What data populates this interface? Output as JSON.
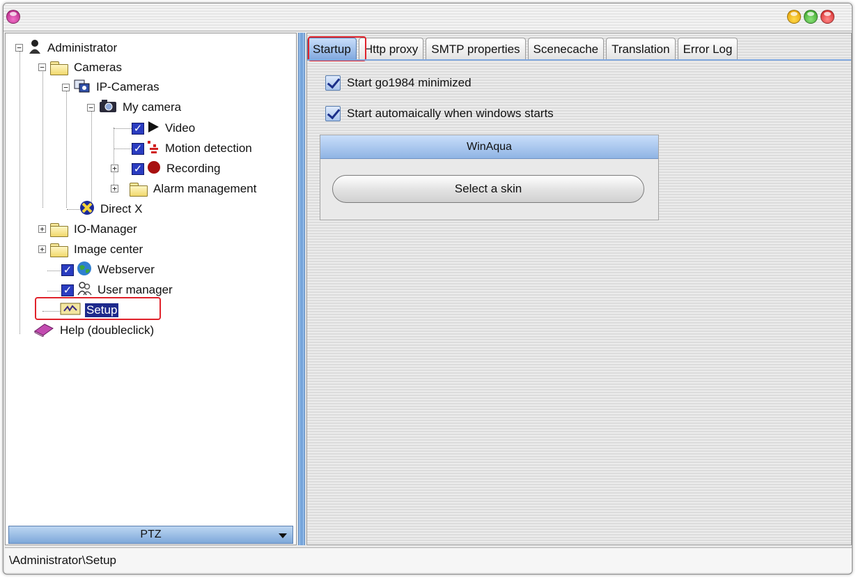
{
  "window": {
    "controls": [
      "minimize-button",
      "maximize-button",
      "close-button"
    ]
  },
  "tree": {
    "root": "Administrator",
    "cameras": "Cameras",
    "ip_cameras": "IP-Cameras",
    "my_camera": "My camera",
    "video": "Video",
    "motion_detection": "Motion detection",
    "recording": "Recording",
    "alarm_management": "Alarm management",
    "direct_x": "Direct X",
    "io_manager": "IO-Manager",
    "image_center": "Image center",
    "webserver": "Webserver",
    "user_manager": "User manager",
    "setup": "Setup",
    "help": "Help (doubleclick)"
  },
  "ptz_dropdown": {
    "label": "PTZ"
  },
  "tabs": [
    "Startup",
    "Http proxy",
    "SMTP properties",
    "Scenecache",
    "Translation",
    "Error Log"
  ],
  "active_tab": "Startup",
  "startup": {
    "minimized_label": "Start go1984 minimized",
    "minimized_checked": true,
    "autostart_label": "Start automaically when windows starts",
    "autostart_checked": true
  },
  "skin": {
    "name": "WinAqua",
    "button_label": "Select a skin"
  },
  "statusbar": {
    "path": "\\Administrator\\Setup"
  },
  "colors": {
    "accent_blue": "#7fa7de",
    "selection": "#1e2a8c",
    "highlight_red": "#e0222b"
  }
}
